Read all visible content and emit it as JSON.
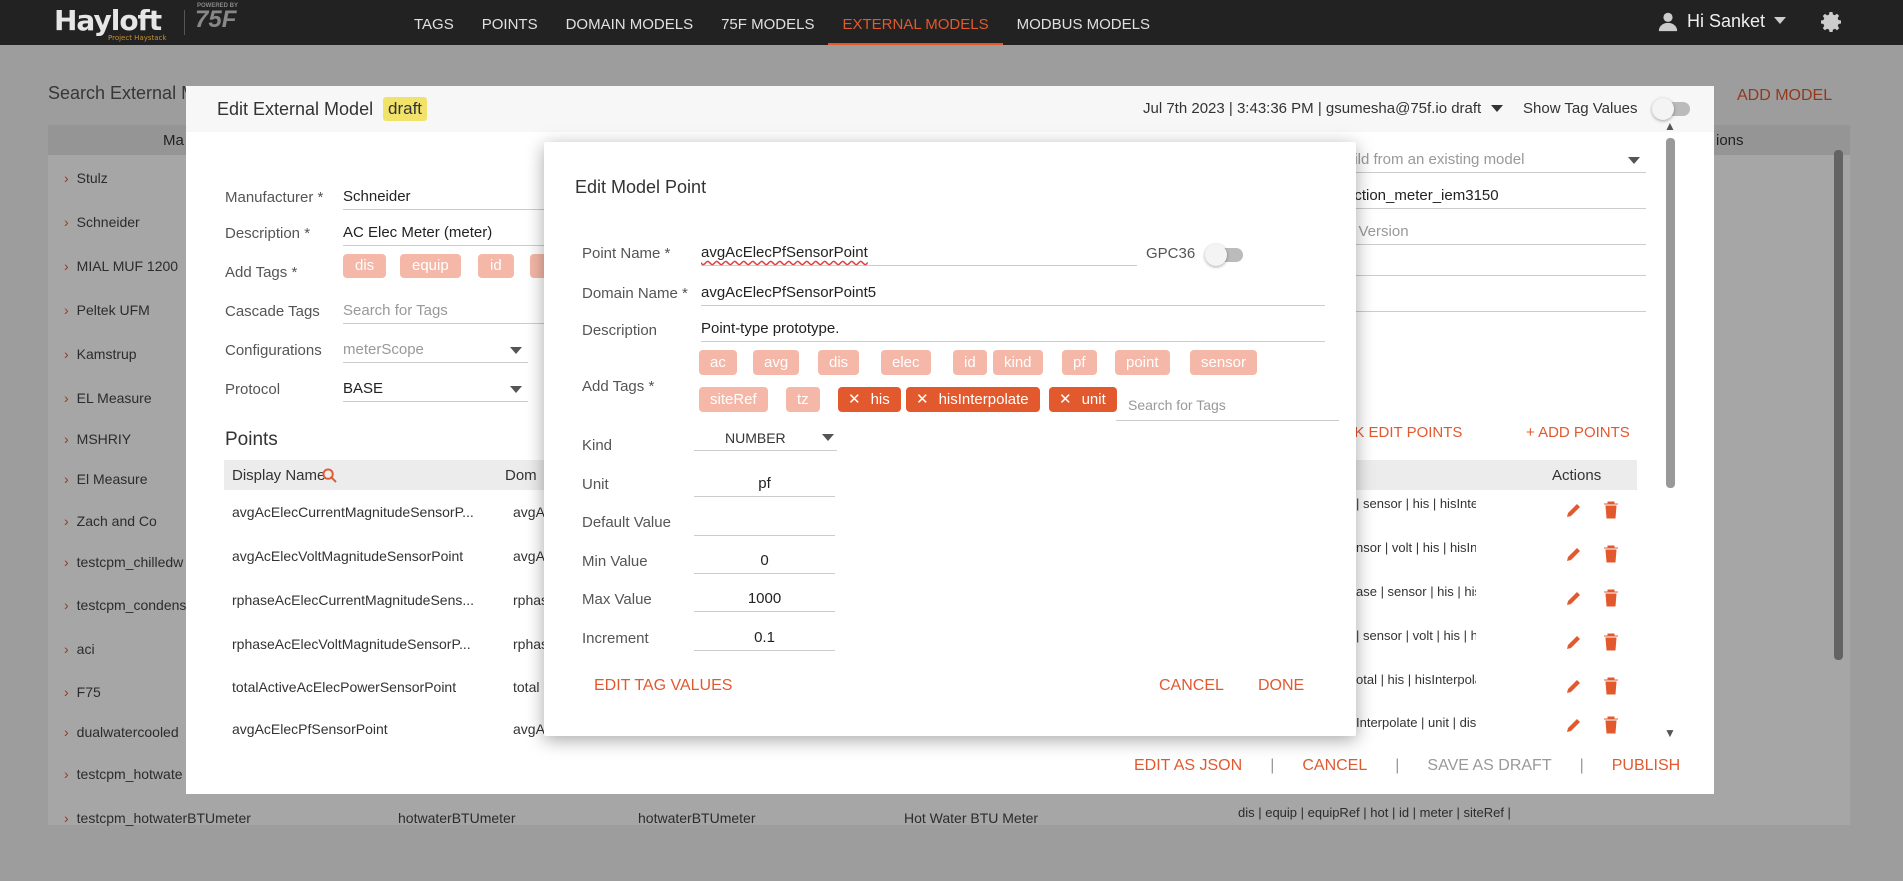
{
  "app": {
    "brand": "Hayloft",
    "brand_sub": "Project Haystack",
    "powered_by": "POWERED BY",
    "partner_logo": "75F",
    "nav": [
      "TAGS",
      "POINTS",
      "DOMAIN MODELS",
      "75F MODELS",
      "EXTERNAL MODELS",
      "MODBUS MODELS"
    ],
    "user_greeting": "Hi Sanket",
    "accent_color": "#e2592e"
  },
  "background": {
    "search_label": "Search External M",
    "add_model": "ADD MODEL",
    "col_manufacturer": "Ma",
    "col_actions": "ions",
    "rows": [
      "Stulz",
      "Schneider",
      "MIAL MUF 1200",
      "Peltek UFM",
      "Kamstrup",
      "EL Measure",
      "MSHRIY",
      "El Measure",
      "Zach and Co",
      "testcpm_chilledw",
      "testcpm_condens",
      "aci",
      "F75",
      "dualwatercooled",
      "testcpm_hotwate",
      "testcpm_hotwaterBTUmeter"
    ],
    "last_row_cols": [
      "hotwaterBTUmeter",
      "hotwaterBTUmeter",
      "Hot Water BTU Meter",
      "dis | equip | equipRef | hot | id | meter | siteRef |"
    ]
  },
  "ext_dialog": {
    "title": "Edit External Model",
    "status": "draft",
    "meta": "Jul 7th 2023 | 3:43:36 PM | gsumesha@75f.io draft",
    "show_tag_values": "Show Tag Values",
    "fields": {
      "manufacturer_label": "Manufacturer *",
      "manufacturer_value": "Schneider",
      "description_label": "Description *",
      "description_value": "AC Elec Meter (meter)",
      "add_tags_label": "Add Tags *",
      "tags": [
        "dis",
        "equip",
        "id"
      ],
      "cascade_label": "Cascade Tags",
      "cascade_placeholder": "Search for Tags",
      "config_label": "Configurations",
      "config_value": "meterScope",
      "protocol_label": "Protocol",
      "protocol_value": "BASE"
    },
    "right": {
      "build_from": "uild from an existing model",
      "model_name": "nction_meter_iem3150",
      "version_placeholder": "e Version"
    },
    "points_title": "Points",
    "bulk_edit": "LK EDIT POINTS",
    "add_points": "+ ADD POINTS",
    "table_headers": {
      "display_name": "Display Name",
      "domain": "Dom",
      "actions": "Actions"
    },
    "points": [
      {
        "name": "avgAcElecCurrentMagnitudeSensorP...",
        "domain": "avgA",
        "tags": "| sensor | his | hisInterpola"
      },
      {
        "name": "avgAcElecVoltMagnitudeSensorPoint",
        "domain": "avgA",
        "tags": "nsor | volt | his | hisInterpo"
      },
      {
        "name": "rphaseAcElecCurrentMagnitudeSens...",
        "domain": "rphas",
        "tags": "ase | sensor | his | hisInterp"
      },
      {
        "name": "rphaseAcElecVoltMagnitudeSensorP...",
        "domain": "rphas",
        "tags": "| sensor | volt | his | hisInte"
      },
      {
        "name": "totalActiveAcElecPowerSensorPoint",
        "domain": "total",
        "tags": "otal | his | hisInterpolate |"
      },
      {
        "name": "avgAcElecPfSensorPoint",
        "domain": "avgA",
        "tags": "Interpolate | unit | dis | id |"
      }
    ],
    "footer": {
      "edit_json": "EDIT AS JSON",
      "cancel": "CANCEL",
      "save_draft": "SAVE AS DRAFT",
      "publish": "PUBLISH"
    }
  },
  "point_dialog": {
    "title": "Edit Model Point",
    "point_name_label": "Point Name *",
    "point_name_value": "avgAcElecPfSensorPoint",
    "gpc_label": "GPC36",
    "domain_name_label": "Domain Name *",
    "domain_name_value": "avgAcElecPfSensorPoint5",
    "description_label": "Description",
    "description_value": "Point-type prototype.",
    "add_tags_label": "Add Tags *",
    "faded_tags": [
      "ac",
      "avg",
      "dis",
      "elec",
      "id",
      "kind",
      "pf",
      "point",
      "sensor",
      "siteRef",
      "tz"
    ],
    "active_tags": [
      "his",
      "hisInterpolate",
      "unit"
    ],
    "tag_search_placeholder": "Search for Tags",
    "kind_label": "Kind",
    "kind_value": "NUMBER",
    "unit_label": "Unit",
    "unit_value": "pf",
    "default_label": "Default Value",
    "default_value": "",
    "min_label": "Min Value",
    "min_value": "0",
    "max_label": "Max Value",
    "max_value": "1000",
    "increment_label": "Increment",
    "increment_value": "0.1",
    "edit_tag_values": "EDIT TAG VALUES",
    "cancel": "CANCEL",
    "done": "DONE"
  }
}
